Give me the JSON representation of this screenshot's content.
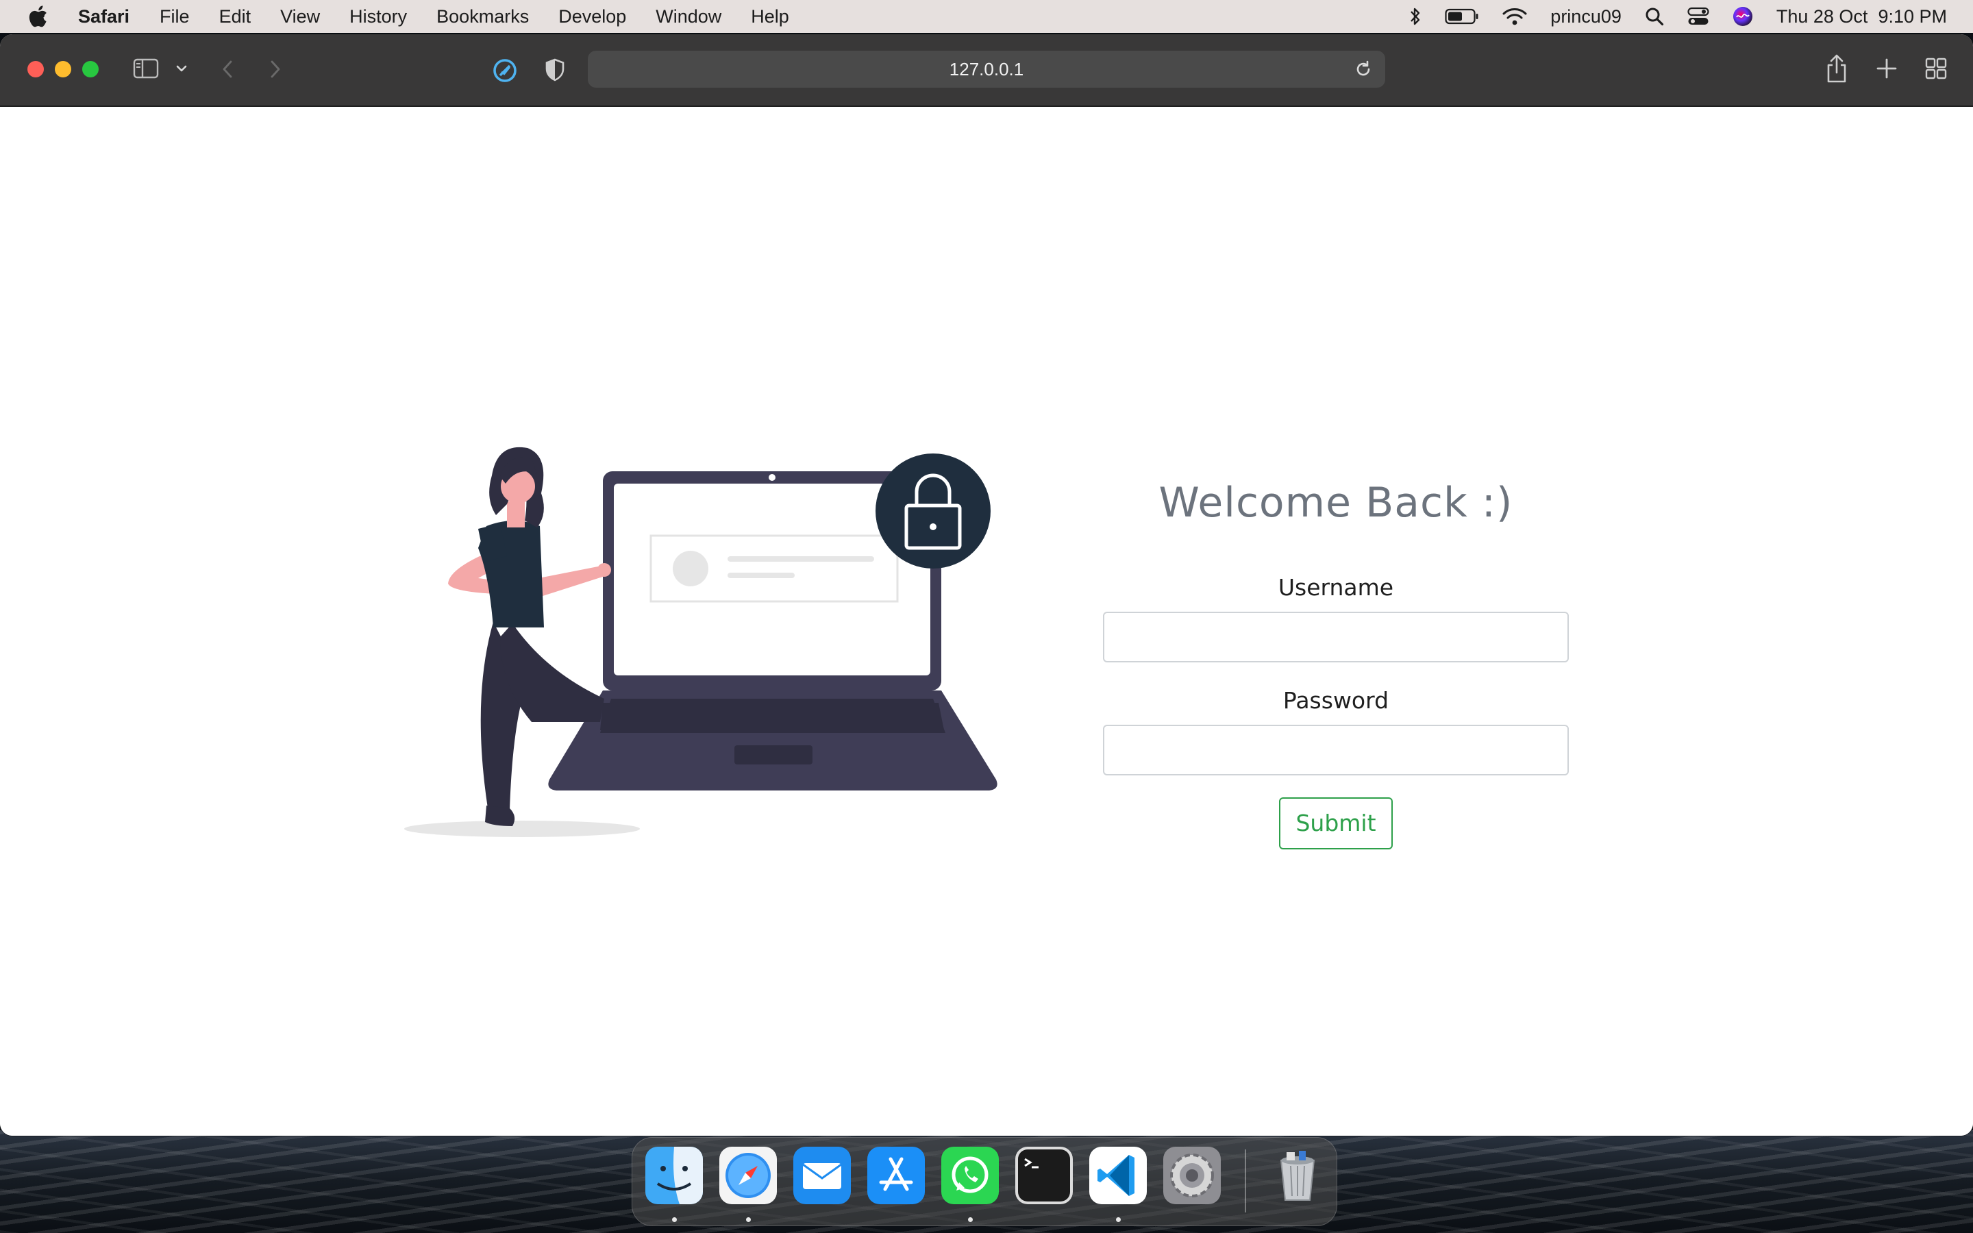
{
  "menubar": {
    "app_name": "Safari",
    "items": [
      "File",
      "Edit",
      "View",
      "History",
      "Bookmarks",
      "Develop",
      "Window",
      "Help"
    ],
    "username": "princu09",
    "datetime": "Thu 28 Oct  9:10 PM"
  },
  "browser": {
    "url": "127.0.0.1"
  },
  "page": {
    "title": "Welcome Back :)",
    "username_label": "Username",
    "password_label": "Password",
    "username_value": "",
    "password_value": "",
    "submit_label": "Submit"
  },
  "dock": {
    "apps": [
      "finder-icon",
      "safari-icon",
      "mail-icon",
      "app-store-icon",
      "whatsapp-icon",
      "terminal-icon",
      "vscode-icon",
      "system-preferences-icon",
      "trash-icon"
    ]
  },
  "colors": {
    "accent_green": "#2da04a",
    "heading_gray": "#6c737d",
    "illustration_dark": "#3f3d56",
    "illustration_navy": "#1f2e3e",
    "skin_pink": "#f4a8a8"
  }
}
